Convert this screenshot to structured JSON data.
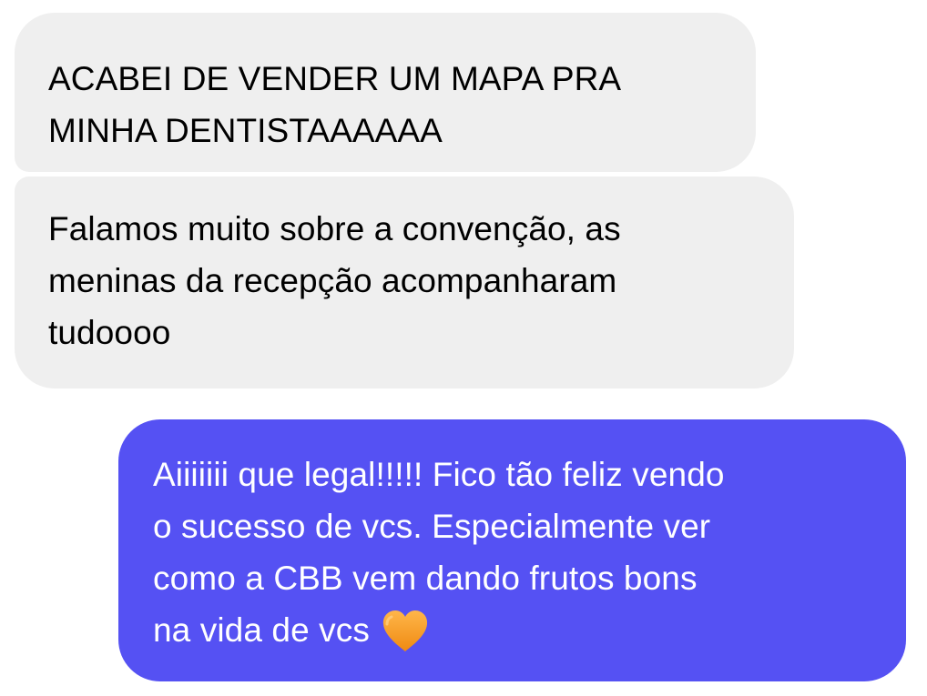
{
  "conversation": {
    "messages": [
      {
        "direction": "incoming",
        "lines": [
          "ACABEI DE VENDER UM MAPA PRA",
          "MINHA DENTISTAAAAAA"
        ]
      },
      {
        "direction": "incoming",
        "lines": [
          "Falamos muito sobre a convenção, as",
          "meninas da recepção acompanharam",
          "tudoooo"
        ]
      },
      {
        "direction": "outgoing",
        "lines": [
          "Aiiiiiii que legal!!!!! Fico tão feliz vendo",
          "o sucesso de vcs. Especialmente ver",
          "como a CBB vem dando frutos bons",
          "na vida de vcs"
        ],
        "trailing_icon": "orange-heart-icon"
      }
    ]
  },
  "colors": {
    "page_background": "#ffffff",
    "incoming_bubble": "#efefef",
    "incoming_text": "#000000",
    "outgoing_bubble": "#5551f3",
    "outgoing_text": "#ffffff",
    "heart": "#f6a12f"
  }
}
